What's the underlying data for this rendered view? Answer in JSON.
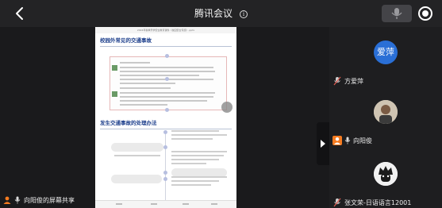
{
  "header": {
    "title": "腾讯会议",
    "info_icon": "info-icon",
    "back_icon": "chevron-left-icon",
    "mic_icon": "mic-icon",
    "record_icon": "record-icon"
  },
  "document": {
    "file_title": "2024年春季开学安全教育课件（校园安全专题）.pptx",
    "section1_title": "校园外常见的交通事故",
    "section2_title": "发生交通事故的处理办法"
  },
  "screen_share": {
    "label": "向阳俊的屏幕共享"
  },
  "participants": [
    {
      "avatar_text": "爱萍",
      "name": "方爱萍",
      "avatar_color": "#2a6fd6",
      "speaking": false
    },
    {
      "avatar_text": "",
      "name": "向阳俊",
      "avatar_color": "#d9d2c5",
      "speaking": true
    },
    {
      "avatar_text": "",
      "name": "张文荣-日语语言12001",
      "avatar_color": "#f2f2f2",
      "speaking": false
    }
  ],
  "colors": {
    "accent_orange": "#f57b20",
    "avatar_blue": "#2a6fd6",
    "doc_title_blue": "#1d3f8c"
  }
}
